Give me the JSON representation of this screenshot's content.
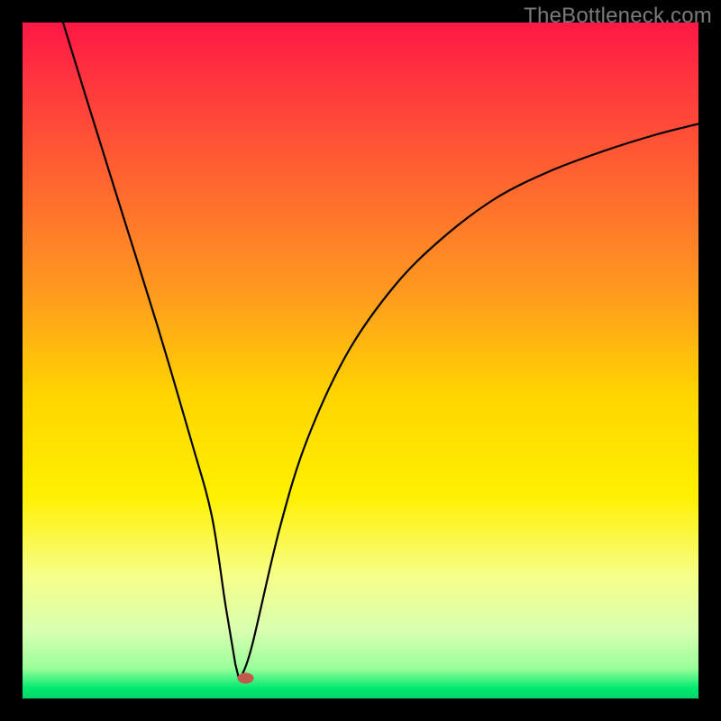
{
  "watermark": "TheBottleneck.com",
  "chart_data": {
    "type": "line",
    "title": "",
    "xlabel": "",
    "ylabel": "",
    "xlim": [
      0,
      100
    ],
    "ylim": [
      0,
      100
    ],
    "note": "Bottleneck V-curve over a red-to-green vertical gradient. Minimum (optimal point) at x≈32. Values estimated from pixel positions; axes are unlabeled.",
    "series": [
      {
        "name": "bottleneck-curve",
        "x": [
          6,
          10,
          15,
          20,
          25,
          28,
          30,
          31.5,
          32,
          32.5,
          34,
          38,
          42,
          48,
          55,
          62,
          70,
          78,
          86,
          94,
          100
        ],
        "values": [
          100,
          87,
          71,
          55,
          38,
          27,
          14,
          5,
          3,
          3.5,
          8,
          25,
          38,
          51,
          61,
          68,
          74,
          78,
          81,
          83.5,
          85
        ]
      }
    ],
    "marker": {
      "x": 33,
      "y": 3,
      "color": "#c15a4a"
    },
    "gradient_stops": [
      {
        "offset": 0.0,
        "color": "#ff1845"
      },
      {
        "offset": 0.1,
        "color": "#ff3a3d"
      },
      {
        "offset": 0.25,
        "color": "#ff6a2e"
      },
      {
        "offset": 0.4,
        "color": "#ff9a1f"
      },
      {
        "offset": 0.55,
        "color": "#ffd400"
      },
      {
        "offset": 0.7,
        "color": "#fff000"
      },
      {
        "offset": 0.82,
        "color": "#f6ff8a"
      },
      {
        "offset": 0.9,
        "color": "#d8ffb0"
      },
      {
        "offset": 0.955,
        "color": "#9bff9b"
      },
      {
        "offset": 0.985,
        "color": "#00e96f"
      },
      {
        "offset": 1.0,
        "color": "#00d768"
      }
    ]
  }
}
